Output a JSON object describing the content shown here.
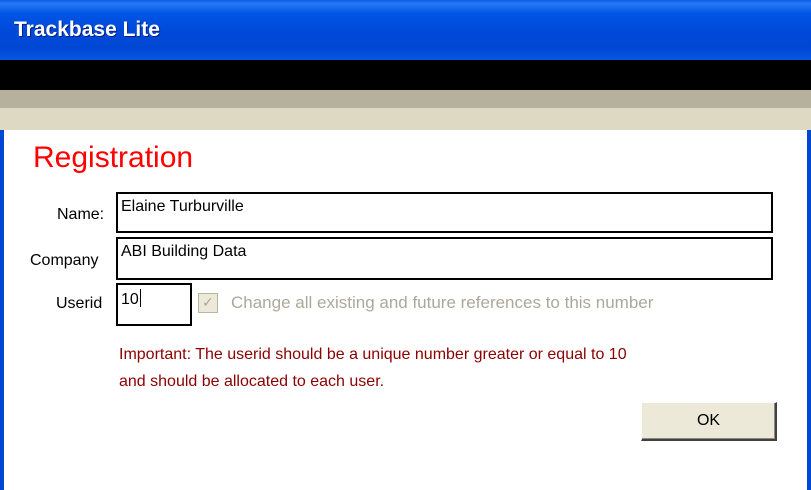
{
  "window": {
    "title": "Trackbase Lite"
  },
  "form": {
    "heading": "Registration",
    "name_label": "Name:",
    "name_value": "Elaine Turburville",
    "company_label": "Company",
    "company_value": "ABI Building Data",
    "userid_label": "Userid",
    "userid_value": "10",
    "change_refs_label": "Change all existing and future references to this number",
    "change_refs_checked": true,
    "change_refs_enabled": false,
    "note_line1": "Important: The userid should be a unique number greater or equal to 10",
    "note_line2": "and should be allocated to each user.",
    "ok_label": "OK"
  },
  "colors": {
    "titlebar": "#0047d4",
    "heading": "#ff0000",
    "note": "#8b0000",
    "disabled_text": "#aca899"
  }
}
